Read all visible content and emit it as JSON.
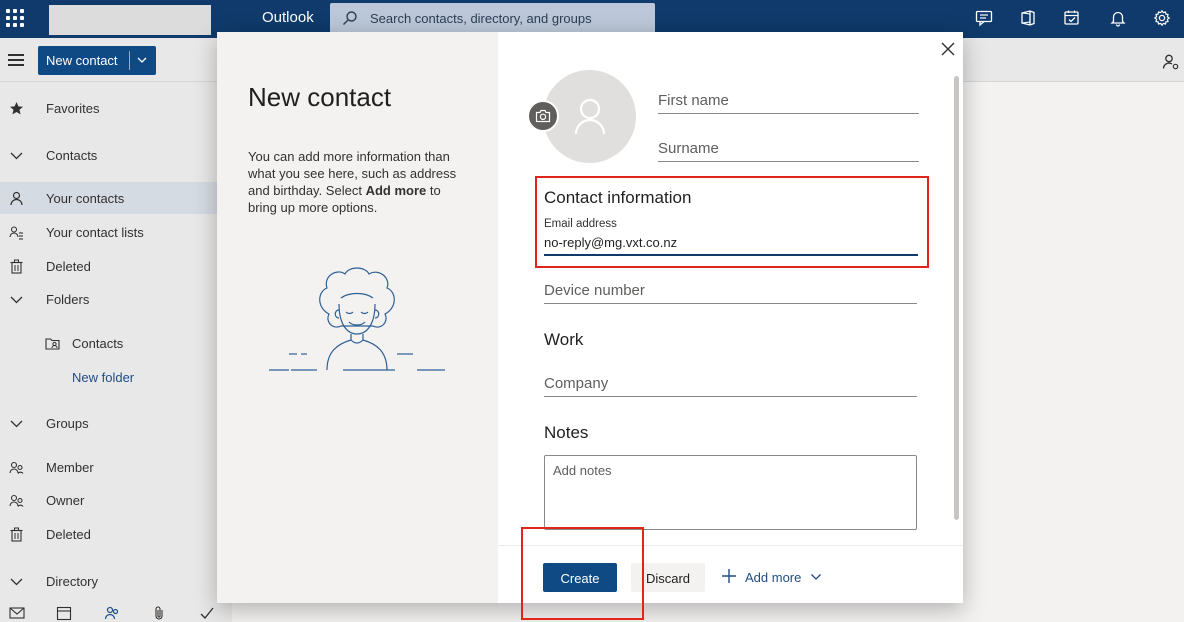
{
  "app": {
    "brand": "Outlook",
    "search_placeholder": "Search contacts, directory, and groups"
  },
  "commandbar": {
    "new_contact_label": "New contact"
  },
  "nav": {
    "favorites": "Favorites",
    "contacts": "Contacts",
    "your_contacts": "Your contacts",
    "your_contact_lists": "Your contact lists",
    "deleted": "Deleted",
    "folders": "Folders",
    "folder_contacts": "Contacts",
    "new_folder": "New folder",
    "groups": "Groups",
    "member": "Member",
    "owner": "Owner",
    "groups_deleted": "Deleted",
    "directory": "Directory"
  },
  "dialog": {
    "title": "New contact",
    "desc_part1": "You can add more information than what you see here, such as address and birthday. Select ",
    "desc_bold": "Add more",
    "desc_part2": " to bring up more options.",
    "first_name_placeholder": "First name",
    "surname_placeholder": "Surname",
    "contact_info_heading": "Contact information",
    "email_label": "Email address",
    "email_value": "no-reply@mg.vxt.co.nz",
    "device_number_placeholder": "Device number",
    "work_heading": "Work",
    "company_placeholder": "Company",
    "notes_heading": "Notes",
    "notes_placeholder": "Add notes",
    "create_label": "Create",
    "discard_label": "Discard",
    "add_more_label": "Add more"
  },
  "colors": {
    "topbar": "#0f3a6b",
    "primary_button": "#0f4a85",
    "highlight": "#e0251b",
    "link": "#1f4e86"
  }
}
